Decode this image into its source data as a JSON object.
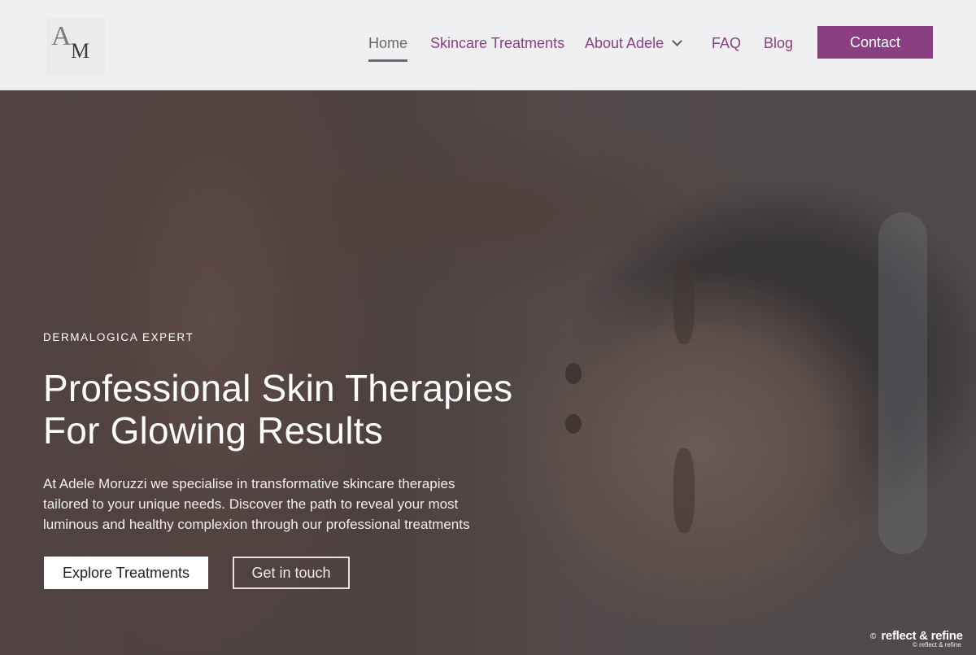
{
  "header": {
    "logo": {
      "letter_top": "A",
      "letter_bottom": "M"
    },
    "nav": [
      {
        "label": "Home",
        "active": true
      },
      {
        "label": "Skincare Treatments",
        "active": false
      },
      {
        "label": "About Adele",
        "active": false,
        "has_dropdown": true
      },
      {
        "label": "FAQ",
        "active": false
      },
      {
        "label": "Blog",
        "active": false
      }
    ],
    "contact_label": "Contact"
  },
  "hero": {
    "eyebrow": "DERMALOGICA EXPERT",
    "headline_lines": [
      "Professional Skin Therapies",
      "For Glowing Results"
    ],
    "description_lines": [
      "At Adele Moruzzi we specialise in transformative skincare therapies",
      "tailored to your unique needs. Discover the path to reveal your most",
      "luminous and healthy complexion through our professional treatments"
    ],
    "primary_button": "Explore Treatments",
    "secondary_button": "Get in touch"
  },
  "watermark": {
    "symbol": "©",
    "text": "reflect & refine",
    "small_text": "© reflect & refine"
  },
  "colors": {
    "accent": "#8a3f82",
    "header_bg": "#f0f0f2",
    "nav_active": "#6a6a6e"
  },
  "icons": {
    "dropdown": "chevron-down-icon"
  }
}
